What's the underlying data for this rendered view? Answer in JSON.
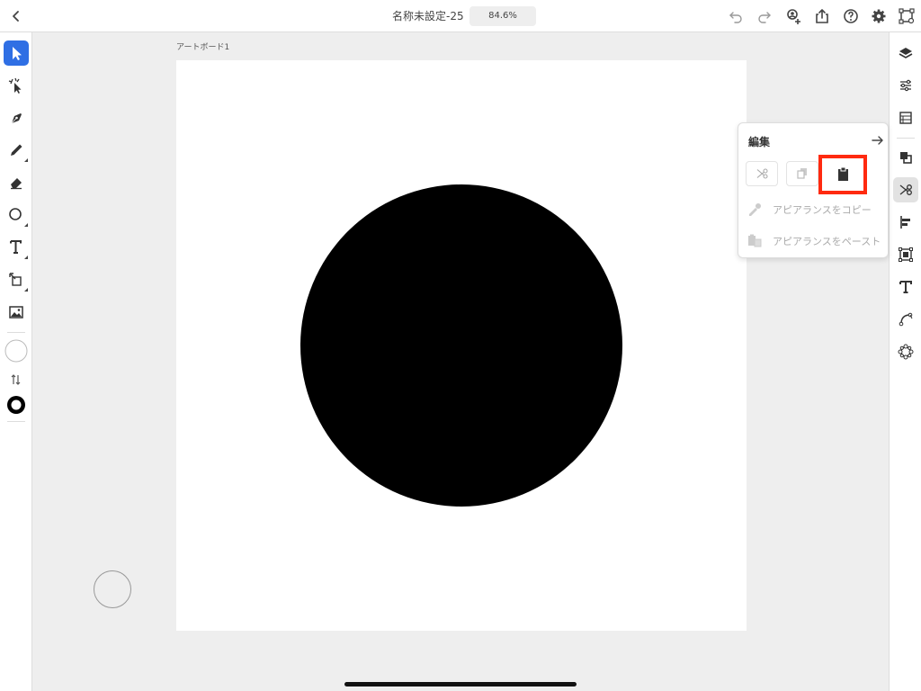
{
  "topbar": {
    "title": "名称未設定-25",
    "zoom": "84.6%",
    "icons": [
      "back-icon",
      "undo-icon",
      "redo-icon",
      "user-add-icon",
      "share-icon",
      "help-icon",
      "settings-icon",
      "artboard-icon"
    ]
  },
  "left_toolbar": {
    "tools": [
      "select-tool",
      "direct-select-tool",
      "pen-tool",
      "pencil-tool",
      "eraser-tool",
      "shape-tool",
      "type-tool",
      "transform-tool",
      "image-tool"
    ],
    "active": "select-tool"
  },
  "right_toolbar": {
    "icons": [
      "layers-icon",
      "properties-icon",
      "libraries-icon",
      "arrange-icon",
      "edit-icon",
      "align-icon",
      "transform-icon",
      "text-icon",
      "path-icon",
      "repeat-icon"
    ],
    "active": "edit-icon"
  },
  "canvas": {
    "artboard_label": "アートボード1",
    "artboard_color": "#ffffff",
    "shape_color": "#000000"
  },
  "edit_panel": {
    "title": "編集",
    "buttons": [
      "cut-icon",
      "copy-icon",
      "paste-icon"
    ],
    "highlighted_button": "paste-icon",
    "highlight_color": "#ff2a10",
    "copy_appearance_label": "アピアランスをコピー",
    "paste_appearance_label": "アピアランスをペースト"
  },
  "colors": {
    "accent": "#2f6fe4",
    "background": "#eeeeee"
  }
}
